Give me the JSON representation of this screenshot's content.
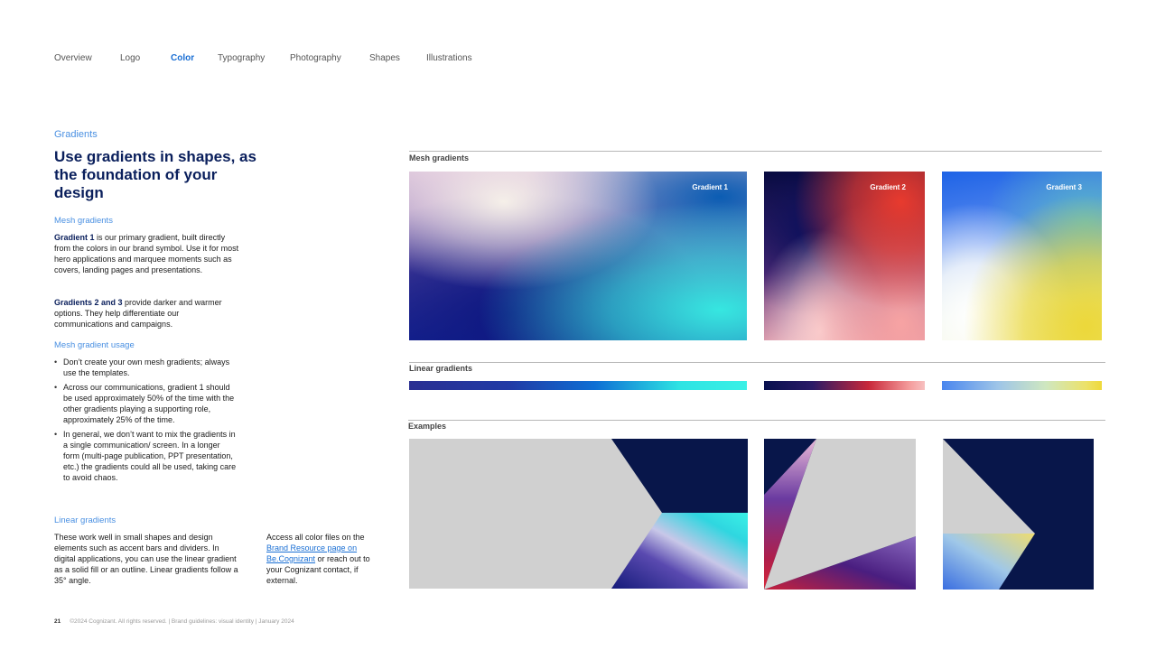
{
  "nav": {
    "items": [
      "Overview",
      "Logo",
      "Color",
      "Typography",
      "Photography",
      "Shapes",
      "Illustrations"
    ],
    "active": "Color"
  },
  "left": {
    "eyebrow": "Gradients",
    "heading": "Use gradients in shapes, as the foundation of your design",
    "mesh_title": "Mesh gradients",
    "gradient1_bold": "Gradient 1",
    "gradient1_text": " is our primary gradient, built directly from the colors in our brand symbol. Use it for most hero applications and marquee moments such as covers, landing pages and presentations.",
    "gradient23_bold": "Gradients 2 and 3",
    "gradient23_text": " provide darker and warmer options. They help differentiate our communications and campaigns.",
    "usage_title": "Mesh gradient usage",
    "usage_bullets": [
      "Don’t create your own mesh gradients; always use the templates.",
      "Across our communications, gradient 1 should be used approximately 50% of the time with the other gradients playing a supporting role, approximately 25% of the time.",
      "In general, we don’t want to mix the gradients in a single communication/ screen. In a longer form (multi-page publication, PPT presentation, etc.) the gradients could all be used, taking care to avoid chaos."
    ],
    "linear_title": "Linear gradients",
    "linear_text": "These work well in small shapes and design elements such as accent bars and dividers. In digital applications, you can use the linear gradient as a solid fill or an outline. Linear gradients follow a 35° angle.",
    "access_text1": "Access all color files on the ",
    "access_link": "Brand Resource page on Be.Cognizant",
    "access_text2": " or reach out to your Cognizant contact, if external."
  },
  "right": {
    "mesh_label": "Mesh gradients",
    "gradients": [
      "Gradient 1",
      "Gradient 2",
      "Gradient 3"
    ],
    "linear_label": "Linear gradients",
    "examples_label": "Examples"
  },
  "footer": {
    "page": "21",
    "text": "©2024 Cognizant. All rights reserved.  |  Brand guidelines: visual identity  |  January 2024"
  },
  "colors": {
    "accent_blue": "#1a6fd4",
    "heading_navy": "#0a1f5c",
    "example_navy": "#08164a",
    "example_gray": "#d0d0d0"
  }
}
